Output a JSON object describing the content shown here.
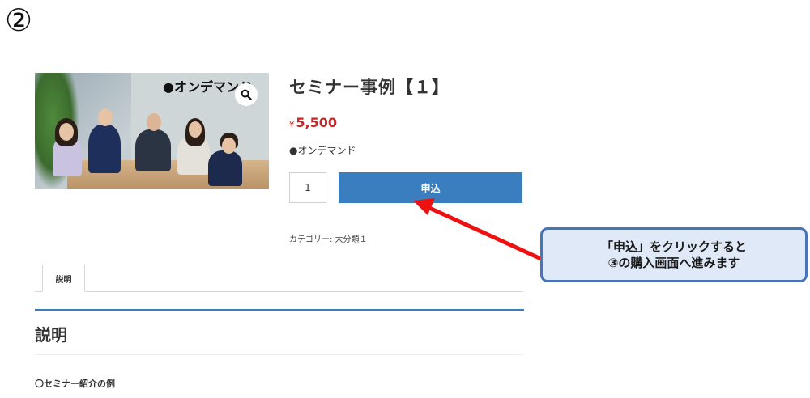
{
  "step": "②",
  "product": {
    "image_banner": "●オンデマンド",
    "title": "セミナー事例【１】",
    "price_currency": "¥",
    "price_value": "5,500",
    "variant": "●オンデマンド",
    "quantity": "1",
    "apply_label": "申込",
    "category": "カテゴリー: 大分類１"
  },
  "tabs": [
    {
      "label": "説明"
    }
  ],
  "description": {
    "heading": "説明",
    "text": "〇セミナー紹介の例"
  },
  "callout": {
    "line1": "「申込」をクリックすると",
    "line2": "③の購入画面へ進みます"
  },
  "colors": {
    "accent": "#3a7ebf",
    "price": "#c0282b",
    "arrow": "#ee1111",
    "callout_border": "#4a74b8",
    "callout_bg": "#dfe9f7"
  },
  "icons": {
    "zoom": "magnifier-icon"
  }
}
